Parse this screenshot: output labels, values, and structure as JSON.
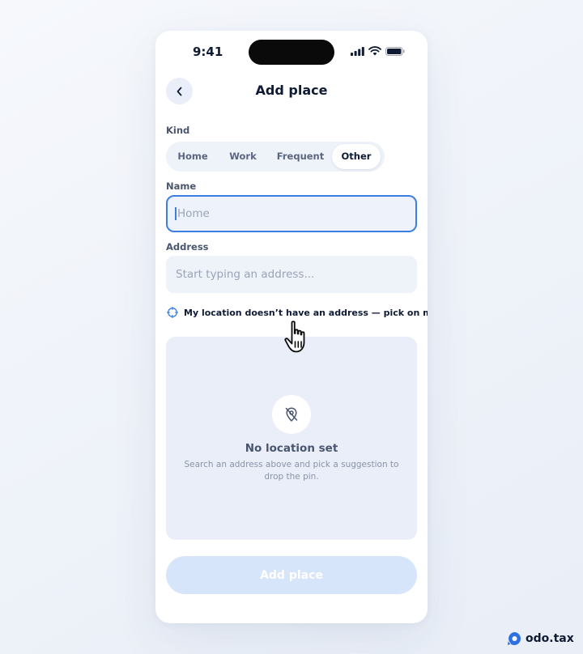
{
  "status_bar": {
    "time": "9:41"
  },
  "header": {
    "title": "Add place",
    "back_icon": "chevron-left-icon"
  },
  "kind": {
    "label": "Kind",
    "options": [
      "Home",
      "Work",
      "Frequent",
      "Other"
    ],
    "selected": "Other"
  },
  "name": {
    "label": "Name",
    "value": "",
    "placeholder": "Home"
  },
  "address": {
    "label": "Address",
    "value": "",
    "placeholder": "Start typing an address..."
  },
  "pick_on_map": {
    "label": "My location doesn’t have an address — pick on map",
    "icon": "crosshair-icon"
  },
  "map": {
    "icon": "location-off-icon",
    "title": "No location set",
    "description": "Search an address above and pick a suggestion to drop the pin."
  },
  "submit": {
    "label": "Add place",
    "disabled": true
  },
  "brand": {
    "name": "odo.tax",
    "logo_icon": "odo-logo-icon"
  },
  "colors": {
    "accent": "#3d7fe0",
    "primary_text": "#0f1b33",
    "field_bg": "#eef2f9",
    "disabled_button": "#d7e5fb"
  }
}
